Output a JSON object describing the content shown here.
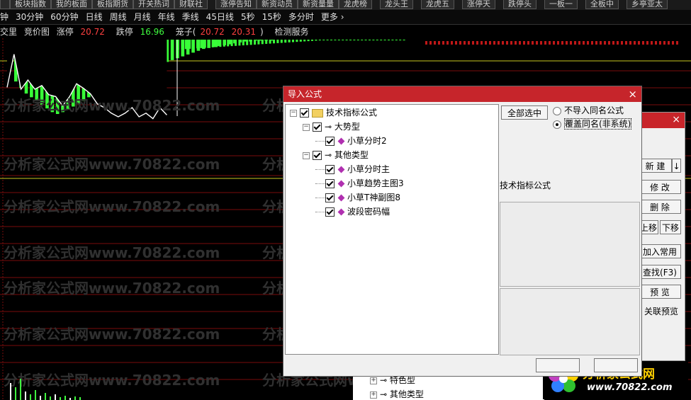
{
  "topbar": {
    "tabs": [
      "",
      "板块指数",
      "我的板面",
      "板指期货",
      "开关热词",
      "财联社",
      "涨停告知",
      "新资动员",
      "新资量量",
      "龙虎榜",
      "龙头王",
      "龙虎五",
      "涨停天",
      "跌停头",
      "一板一",
      "全板中",
      "乡亭亚太"
    ]
  },
  "periodbar": {
    "items": [
      "钟",
      "30分钟",
      "60分钟",
      "日线",
      "周线",
      "月线",
      "年线",
      "季线",
      "45日线",
      "5秒",
      "15秒",
      "多分时",
      "更多 ›"
    ]
  },
  "infobar": {
    "name": "交里",
    "chart_label": "竞价图",
    "up_label": "涨停",
    "up_value": "20.72",
    "down_label": "跌停",
    "down_value": "16.96",
    "cage_label": "笼子(",
    "cage_v1": "20.72",
    "cage_v2": "20.31",
    "cage_close": ")",
    "check_label": "检测服务"
  },
  "watermark": {
    "text": "分析家公式网www.70822.com"
  },
  "chart_data": {
    "type": "area",
    "note": "",
    "bars_values": [
      45,
      52,
      58,
      62,
      66,
      70,
      74,
      78,
      80,
      78,
      75,
      72,
      69,
      66,
      62,
      58,
      55,
      52,
      48,
      45,
      43,
      40,
      38,
      36,
      34,
      32,
      30,
      28,
      26,
      24,
      22,
      20,
      18,
      16,
      14,
      12,
      10,
      9,
      8,
      7,
      6,
      5,
      4,
      3,
      2,
      2,
      1,
      1,
      1,
      1
    ],
    "line_values": [
      62,
      98,
      60,
      70,
      60,
      64,
      54,
      52,
      42,
      52,
      66,
      61,
      55,
      44,
      40,
      34,
      30,
      34,
      40,
      30,
      34,
      28,
      40,
      32
    ],
    "bar_color": "#38ff38",
    "line_color": "#ffffff"
  },
  "dialog": {
    "title": "导入公式",
    "close": "×",
    "tree": {
      "root": "技术指标公式",
      "group1": "大势型",
      "group1_items": [
        "小草分时2"
      ],
      "group2": "其他类型",
      "group2_items": [
        "小草分时主",
        "小草趋势主图3",
        "小草T神副图8",
        "波段密码幅"
      ]
    },
    "select_all": "全部选中",
    "radio_no_import": "不导入同名公式",
    "radio_overwrite": "覆盖同名(非系统)",
    "panel_label": "技术指标公式",
    "ok": "",
    "cancel": ""
  },
  "back_dialog": {
    "close": "×",
    "buttons": {
      "new": "新 建",
      "new_arrow": "↓",
      "modify": "修 改",
      "delete": "删 除",
      "up": "上移",
      "down": "下移",
      "add_common": "加入常用",
      "find": "查找(F3)",
      "preview": "预 览",
      "related_preview": "关联预览"
    }
  },
  "bottom_tree": {
    "items": [
      "特色型",
      "其他类型"
    ]
  },
  "logo": {
    "name": "分析家公式网",
    "url": "www.70822.com"
  }
}
